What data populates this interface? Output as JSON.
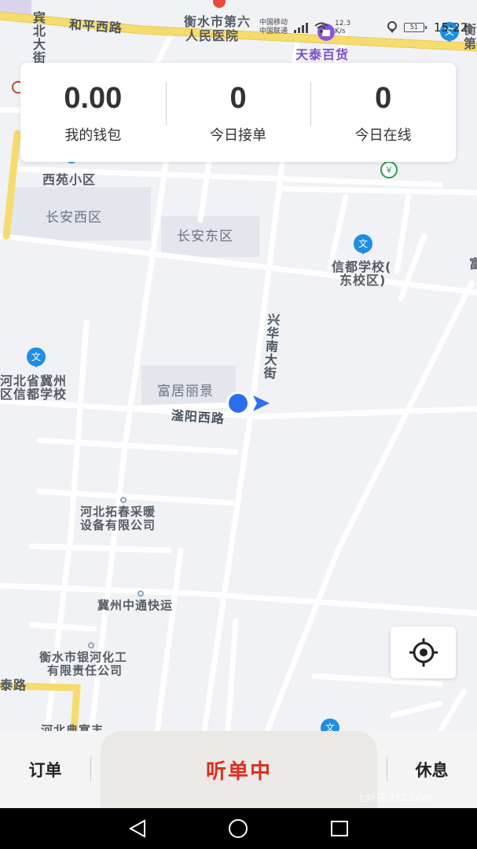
{
  "status_bar": {
    "carrier_line1": "中国移动",
    "carrier_line2": "中国联通",
    "network_speed": "12.3 K/s",
    "battery": "51",
    "time": "15:22"
  },
  "stats": [
    {
      "value": "0.00",
      "label": "我的钱包"
    },
    {
      "value": "0",
      "label": "今日接单"
    },
    {
      "value": "0",
      "label": "今日在线"
    }
  ],
  "map_labels": {
    "hosp": "衡水市第六",
    "hosp2": "人民医院",
    "tiantai": "天泰百货",
    "heping": "和平西路",
    "binbei": "宾北大街",
    "xiyuan": "西苑小区",
    "changan_w": "长安西区",
    "changan_e": "长安东区",
    "xindu1": "信都学校(",
    "xindu2": "东校区)",
    "xinghua": "兴华南大街",
    "hebei1": "河北省冀州",
    "hebei2": "区信都学校",
    "fuju": "富居丽景",
    "fuyang": "滏阳西路",
    "tuochun1": "河北拓春采暖",
    "tuochun2": "设备有限公司",
    "zhongtong": "冀州中通快运",
    "yinhe1": "衡水市银河化工",
    "yinhe2": "有限责任公司",
    "hebei_b": "河北典富丰",
    "tai_lu": "泰路",
    "heng_r": "衡",
    "heng_r2": "第",
    "fu_r": "富",
    "edu": "文"
  },
  "bottom_bar": {
    "orders": "订单",
    "listening": "听单中",
    "rest": "休息"
  },
  "watermark": "七叶子 7YZ.COM",
  "colors": {
    "accent_red": "#e02d1c",
    "location_blue": "#2b6ff0",
    "main_road": "#f5dc6e"
  }
}
